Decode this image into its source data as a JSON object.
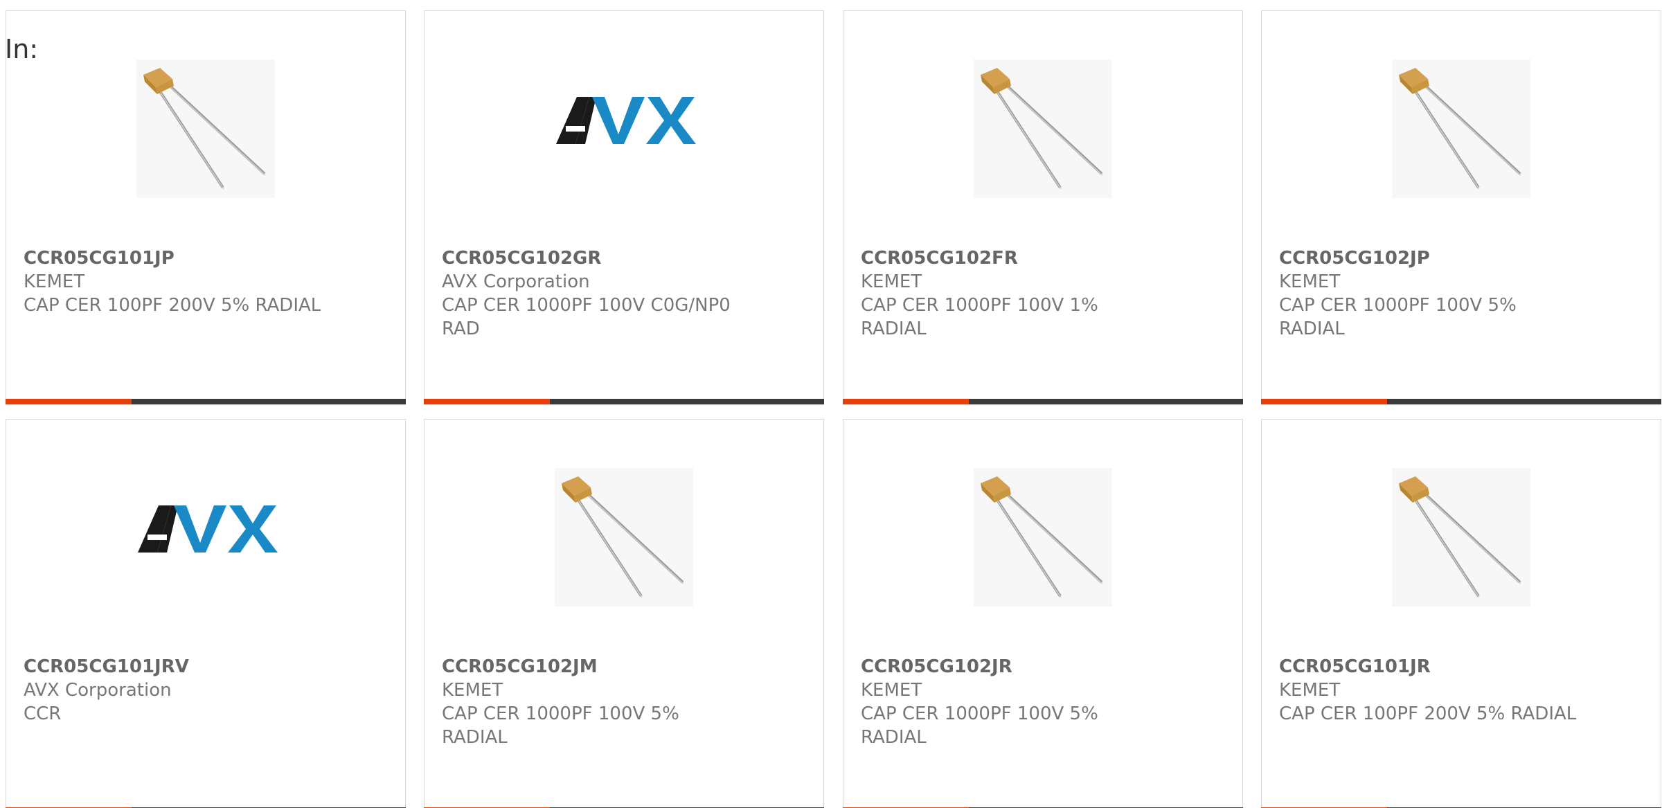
{
  "page": {
    "in_label": "In:"
  },
  "colors": {
    "accent": "#e5400c",
    "bar_dark": "#3a3a3a",
    "text": "#777777",
    "avx_black": "#1a1a1a",
    "avx_blue": "#1a8ac6"
  },
  "products": [
    {
      "part_number": "CCR05CG101JP",
      "manufacturer": "KEMET",
      "description": "CAP CER 100PF 200V 5% RADIAL",
      "image": "capacitor-icon"
    },
    {
      "part_number": "CCR05CG102GR",
      "manufacturer": "AVX Corporation",
      "description": "CAP CER 1000PF 100V C0G/NP0 RAD",
      "image": "avx-logo",
      "logo_text": "AVX"
    },
    {
      "part_number": "CCR05CG102FR",
      "manufacturer": "KEMET",
      "description": "CAP CER 1000PF 100V 1% RADIAL",
      "image": "capacitor-icon"
    },
    {
      "part_number": "CCR05CG102JP",
      "manufacturer": "KEMET",
      "description": "CAP CER 1000PF 100V 5% RADIAL",
      "image": "capacitor-icon"
    },
    {
      "part_number": "CCR05CG101JRV",
      "manufacturer": "AVX Corporation",
      "description": "CCR",
      "image": "avx-logo",
      "logo_text": "AVX"
    },
    {
      "part_number": "CCR05CG102JM",
      "manufacturer": "KEMET",
      "description": "CAP CER 1000PF 100V 5% RADIAL",
      "image": "capacitor-icon"
    },
    {
      "part_number": "CCR05CG102JR",
      "manufacturer": "KEMET",
      "description": "CAP CER 1000PF 100V 5% RADIAL",
      "image": "capacitor-icon"
    },
    {
      "part_number": "CCR05CG101JR",
      "manufacturer": "KEMET",
      "description": "CAP CER 100PF 200V 5% RADIAL",
      "image": "capacitor-icon"
    }
  ]
}
